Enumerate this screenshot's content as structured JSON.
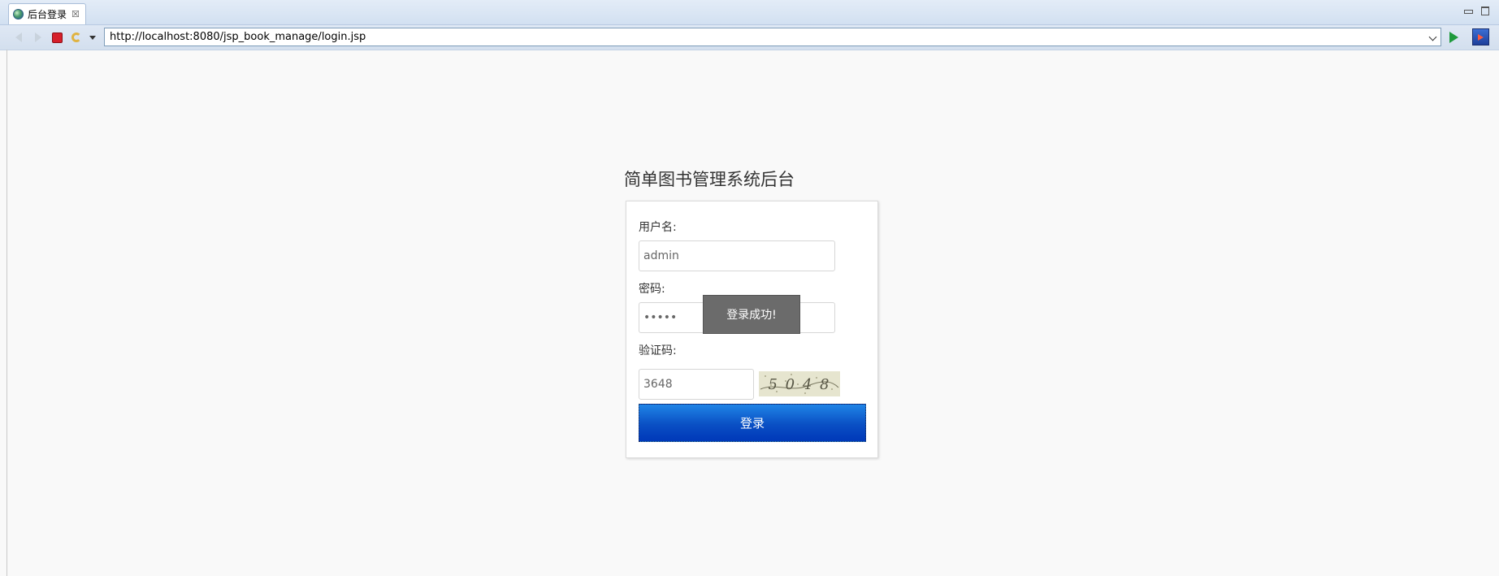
{
  "browser": {
    "tab": {
      "label": "后台登录",
      "close_glyph": "☒",
      "icon": "globe-icon"
    },
    "address_bar": {
      "url": "http://localhost:8080/jsp_book_manage/login.jsp"
    },
    "toolbar_icons": [
      "back-icon",
      "forward-icon",
      "stop-icon",
      "refresh-icon",
      "dropdown-icon",
      "go-icon",
      "external-browser-icon"
    ]
  },
  "page": {
    "title": "简单图书管理系统后台",
    "form": {
      "username_label": "用户名:",
      "username_value": "admin",
      "password_label": "密码:",
      "password_value": "admin",
      "captcha_label": "验证码:",
      "captcha_value": "3648",
      "captcha_image_text": "5 0 4 8",
      "submit_label": "登录"
    },
    "toast": {
      "message": "登录成功!"
    }
  },
  "colors": {
    "button_top": "#1f84e6",
    "button_bottom": "#0038b8",
    "toast_bg": "#6b6b6b",
    "page_bg": "#f9f9f9"
  }
}
